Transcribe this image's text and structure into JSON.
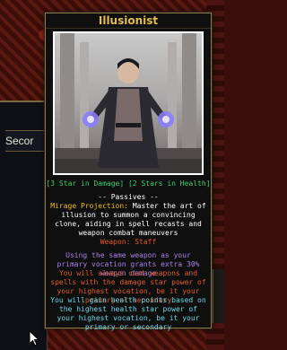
{
  "left_panel": {
    "label": "Secor"
  },
  "tooltip": {
    "title": "Illusionist",
    "stars": "[3 Star in Damage] [2 Stars in Health]",
    "passives_header": "-- Passives --",
    "mirage_name": "Mirage Projection:",
    "mirage_text": "Master the art of illusion to summon a convincing clone, aiding in spell recasts and weapon combat maneuvers",
    "weapon": "Weapon: Staff",
    "desc_purple": "Using the same weapon as your primary vocation grants extra 30% weapon damage",
    "desc_orange": "You will always cast weapons and spells with the damage star power of your highest vocation, be it your primary or secondary",
    "desc_cyan": "You will gain health points based on the highest health star power of your highest vocation, be it your primary or secondary"
  },
  "colors": {
    "title": "#e4be4c",
    "stars": "#3ad06a",
    "mirage_name": "#f0c020",
    "weapon": "#e05a2a",
    "purple": "#a880e8",
    "orange": "#e05a2a",
    "cyan": "#6ad8e8"
  },
  "icons": {
    "cursor": "mouse-pointer-icon"
  }
}
